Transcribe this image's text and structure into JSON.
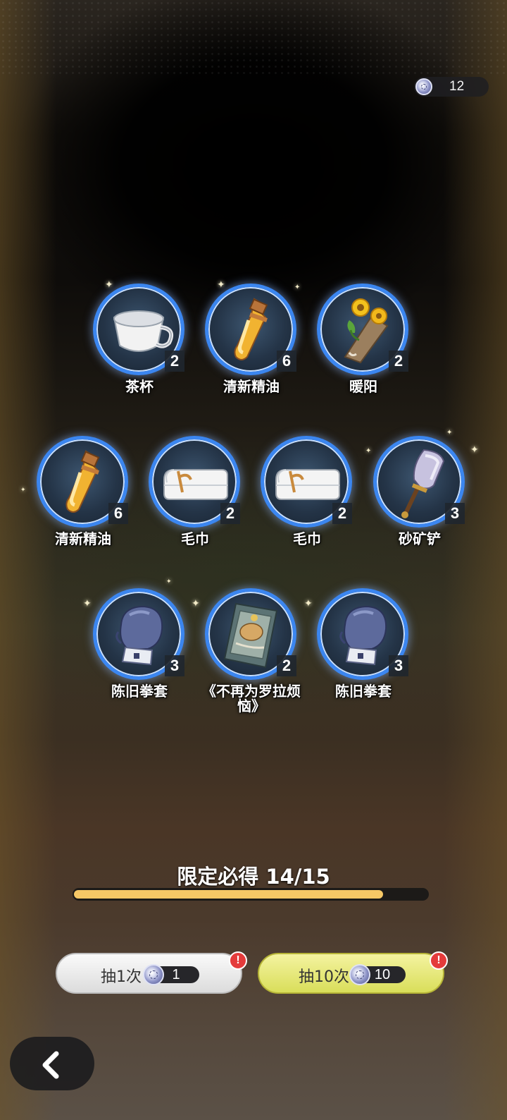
{
  "currency": {
    "amount": "12",
    "icon": "gem-icon"
  },
  "items": [
    {
      "name": "茶杯",
      "count": "2",
      "icon": "teacup-icon"
    },
    {
      "name": "清新精油",
      "count": "6",
      "icon": "essential-oil-icon"
    },
    {
      "name": "暖阳",
      "count": "2",
      "icon": "sunflower-bouquet-icon"
    },
    {
      "name": "清新精油",
      "count": "6",
      "icon": "essential-oil-icon"
    },
    {
      "name": "毛巾",
      "count": "2",
      "icon": "towel-icon"
    },
    {
      "name": "毛巾",
      "count": "2",
      "icon": "towel-icon"
    },
    {
      "name": "砂矿铲",
      "count": "3",
      "icon": "shovel-icon"
    },
    {
      "name": "陈旧拳套",
      "count": "3",
      "icon": "boxing-glove-icon"
    },
    {
      "name": "《不再为罗拉烦恼》",
      "count": "2",
      "icon": "book-icon"
    },
    {
      "name": "陈旧拳套",
      "count": "3",
      "icon": "boxing-glove-icon"
    }
  ],
  "pity": {
    "label": "限定必得 14/15",
    "current": 14,
    "total": 15
  },
  "draw_one": {
    "label": "抽1次",
    "cost": "1",
    "alert": "!"
  },
  "draw_ten": {
    "label": "抽10次",
    "cost": "10",
    "alert": "!"
  },
  "colors": {
    "ring": "#3b86f0",
    "progress": "#f6c866",
    "draw_ten_bg": "#e6e976",
    "alert": "#e43b3b"
  }
}
